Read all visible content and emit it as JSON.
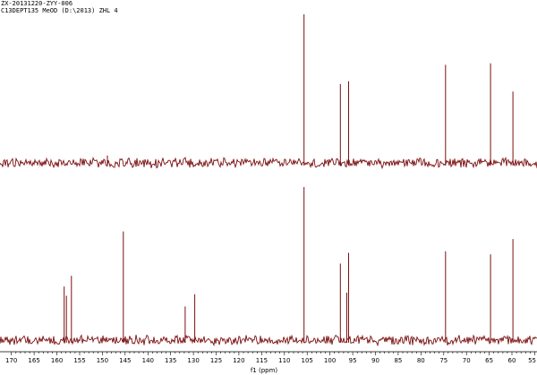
{
  "header": {
    "line1": "ZX-20131220-ZYY-006",
    "line2": "C13DEPT135 MeOD (D:\\2013) ZHL 4"
  },
  "colors": {
    "trace": "#7a0f0f",
    "axis": "#000000",
    "background": "#ffffff"
  },
  "chart_data": {
    "type": "line",
    "title": "",
    "xlabel": "f1 (ppm)",
    "ylabel": "",
    "xlim": [
      172.5,
      54.5
    ],
    "x_reversed": true,
    "grid": false,
    "xticks": [
      170,
      165,
      160,
      155,
      150,
      145,
      140,
      135,
      130,
      125,
      120,
      115,
      110,
      105,
      100,
      95,
      90,
      85,
      80,
      75,
      70,
      65,
      60,
      55
    ],
    "spectra": [
      {
        "name": "",
        "peaks": [
          {
            "ppm": 148.9,
            "height": 0.05
          },
          {
            "ppm": 105.7,
            "height": 1.0
          },
          {
            "ppm": 97.7,
            "height": 0.53
          },
          {
            "ppm": 95.9,
            "height": 0.55
          },
          {
            "ppm": 74.6,
            "height": 0.66
          },
          {
            "ppm": 64.7,
            "height": 0.67
          },
          {
            "ppm": 59.8,
            "height": 0.48
          }
        ]
      },
      {
        "name": "",
        "peaks": [
          {
            "ppm": 158.4,
            "height": 0.35
          },
          {
            "ppm": 157.9,
            "height": 0.29
          },
          {
            "ppm": 156.8,
            "height": 0.42
          },
          {
            "ppm": 145.4,
            "height": 0.71
          },
          {
            "ppm": 131.8,
            "height": 0.22
          },
          {
            "ppm": 129.7,
            "height": 0.3
          },
          {
            "ppm": 105.7,
            "height": 1.0
          },
          {
            "ppm": 97.7,
            "height": 0.5
          },
          {
            "ppm": 96.3,
            "height": 0.31
          },
          {
            "ppm": 95.9,
            "height": 0.57
          },
          {
            "ppm": 74.6,
            "height": 0.58
          },
          {
            "ppm": 64.7,
            "height": 0.56
          },
          {
            "ppm": 59.8,
            "height": 0.66
          }
        ]
      }
    ]
  }
}
